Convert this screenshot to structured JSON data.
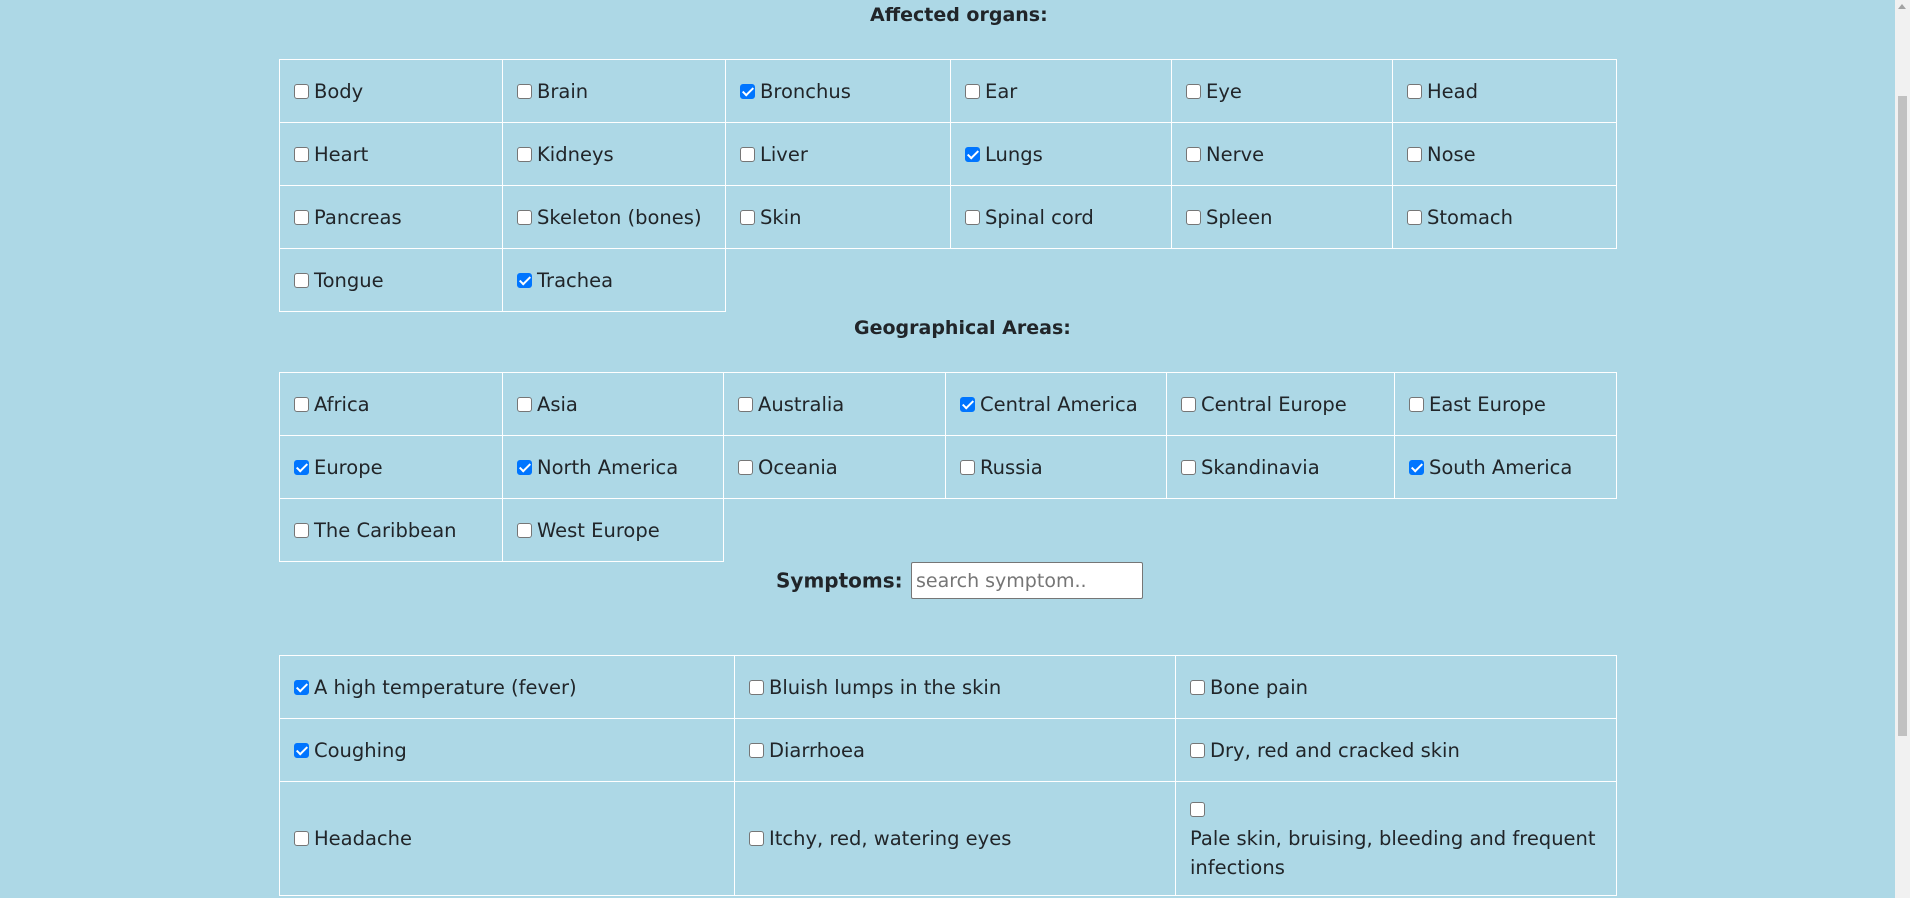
{
  "organs": {
    "title": "Affected organs:",
    "items": [
      {
        "label": "Body",
        "checked": false
      },
      {
        "label": "Brain",
        "checked": false
      },
      {
        "label": "Bronchus",
        "checked": true
      },
      {
        "label": "Ear",
        "checked": false
      },
      {
        "label": "Eye",
        "checked": false
      },
      {
        "label": "Head",
        "checked": false
      },
      {
        "label": "Heart",
        "checked": false
      },
      {
        "label": "Kidneys",
        "checked": false
      },
      {
        "label": "Liver",
        "checked": false
      },
      {
        "label": "Lungs",
        "checked": true
      },
      {
        "label": "Nerve",
        "checked": false
      },
      {
        "label": "Nose",
        "checked": false
      },
      {
        "label": "Pancreas",
        "checked": false
      },
      {
        "label": "Skeleton (bones)",
        "checked": false
      },
      {
        "label": "Skin",
        "checked": false
      },
      {
        "label": "Spinal cord",
        "checked": false
      },
      {
        "label": "Spleen",
        "checked": false
      },
      {
        "label": "Stomach",
        "checked": false
      },
      {
        "label": "Tongue",
        "checked": false
      },
      {
        "label": "Trachea",
        "checked": true
      }
    ]
  },
  "areas": {
    "title": "Geographical Areas:",
    "items": [
      {
        "label": "Africa",
        "checked": false
      },
      {
        "label": "Asia",
        "checked": false
      },
      {
        "label": "Australia",
        "checked": false
      },
      {
        "label": "Central America",
        "checked": true
      },
      {
        "label": "Central Europe",
        "checked": false
      },
      {
        "label": "East Europe",
        "checked": false
      },
      {
        "label": "Europe",
        "checked": true
      },
      {
        "label": "North America",
        "checked": true
      },
      {
        "label": "Oceania",
        "checked": false
      },
      {
        "label": "Russia",
        "checked": false
      },
      {
        "label": "Skandinavia",
        "checked": false
      },
      {
        "label": "South America",
        "checked": true
      },
      {
        "label": "The Caribbean",
        "checked": false
      },
      {
        "label": "West Europe",
        "checked": false
      }
    ]
  },
  "symptoms": {
    "label": "Symptoms:",
    "search_value": "",
    "search_placeholder": "search symptom..",
    "items": [
      {
        "label": "A high temperature (fever)",
        "checked": true
      },
      {
        "label": "Bluish lumps in the skin",
        "checked": false
      },
      {
        "label": "Bone pain",
        "checked": false
      },
      {
        "label": "Coughing",
        "checked": true
      },
      {
        "label": "Diarrhoea",
        "checked": false
      },
      {
        "label": "Dry, red and cracked skin",
        "checked": false
      },
      {
        "label": "Headache",
        "checked": false
      },
      {
        "label": "Itchy, red, watering eyes",
        "checked": false
      },
      {
        "label": "Pale skin, bruising, bleeding and frequent infections",
        "checked": false
      }
    ]
  },
  "colors": {
    "background": "#add8e6",
    "checkbox_checked": "#0075ff",
    "cell_border": "#ffffff"
  }
}
